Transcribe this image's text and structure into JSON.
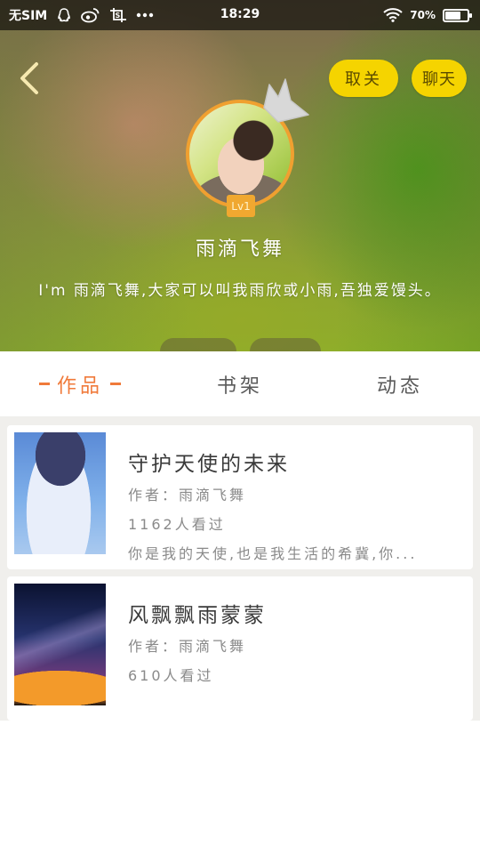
{
  "status_bar": {
    "carrier": "无SIM",
    "time": "18:29",
    "battery": "70",
    "battery_level": 0.7,
    "icons": [
      "qq-icon",
      "weibo-icon",
      "screenshot-icon",
      "more-dots-icon",
      "wifi-icon",
      "battery-icon"
    ]
  },
  "header": {
    "unfollow_label": "取关",
    "chat_label": "聊天"
  },
  "profile": {
    "level": "Lv1",
    "username": "雨滴飞舞",
    "bio": "I'm 雨滴飞舞,大家可以叫我雨欣或小雨,吾独爱馒头。"
  },
  "tabs": [
    {
      "label": "作品",
      "active": true
    },
    {
      "label": "书架",
      "active": false
    },
    {
      "label": "动态",
      "active": false
    }
  ],
  "works": [
    {
      "title": "守护天使的未来",
      "author": "作者：雨滴飞舞",
      "views": "1162人看过",
      "description": "你是我的天使,也是我生活的希冀,你..."
    },
    {
      "title": "风飘飘雨蒙蒙",
      "author": "作者：雨滴飞舞",
      "views": "610人看过"
    }
  ],
  "colors": {
    "accent": "#f07a3a",
    "button_yellow": "#f5d400",
    "level_badge": "#f0a830"
  }
}
